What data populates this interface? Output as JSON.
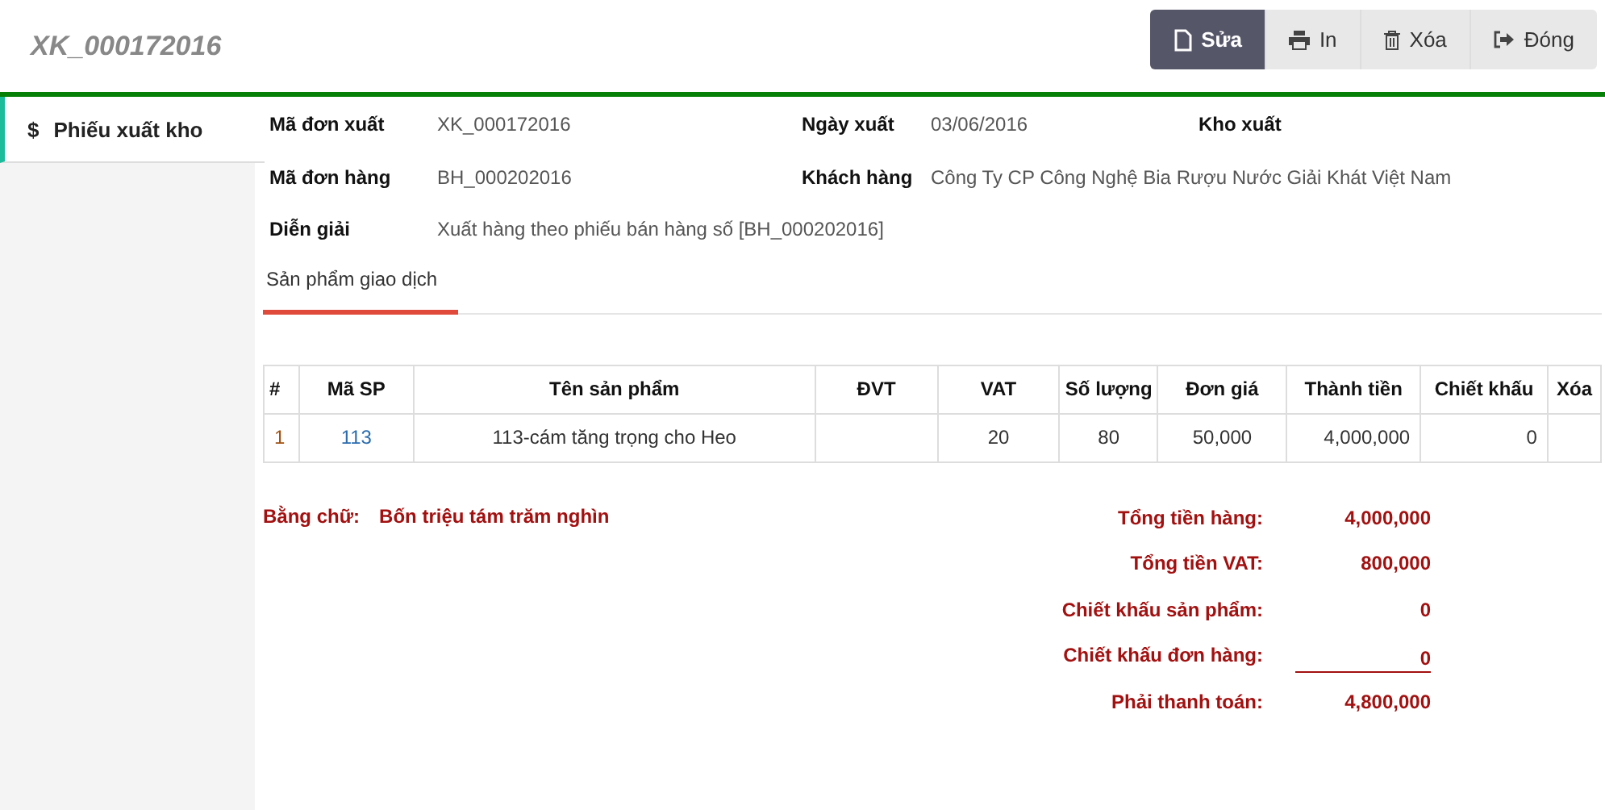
{
  "header": {
    "title": "XK_000172016"
  },
  "buttons": [
    {
      "label": "Sửa",
      "kind": "primary"
    },
    {
      "label": "In",
      "kind": "default"
    },
    {
      "label": "Xóa",
      "kind": "default"
    },
    {
      "label": "Đóng",
      "kind": "default"
    }
  ],
  "sidebar": {
    "items": [
      {
        "icon": "$",
        "label": "Phiếu xuất kho",
        "selected": true
      }
    ]
  },
  "details": [
    [
      {
        "label": "Mã đơn xuất",
        "value": "XK_000172016"
      },
      {
        "label": "Ngày xuất",
        "value": "03/06/2016"
      },
      {
        "label": "Kho xuất"
      }
    ],
    [
      {
        "label": "Mã đơn hàng",
        "value": "BH_000202016"
      },
      {
        "label": "Khách hàng",
        "value": "Công Ty CP Công Nghệ Bia Rượu Nước Giải Khát Việt Nam"
      }
    ],
    [
      {
        "label": "Diễn giải",
        "value": "Xuất hàng theo phiếu bán hàng số [BH_000202016]"
      }
    ]
  ],
  "tabs": [
    {
      "label": "Sản phẩm giao dịch",
      "selected": true
    }
  ],
  "table": {
    "columns": [
      "#",
      "Mã SP",
      "Tên sản phẩm",
      "ĐVT",
      "VAT",
      "Số lượng",
      "Đơn giá",
      "Thành tiền",
      "Chiết khấu",
      "Xóa"
    ],
    "rows": [
      [
        "1",
        "113",
        "113-cám tăng trọng cho Heo",
        "",
        "20",
        "80",
        "50,000",
        "4,000,000",
        "0",
        ""
      ]
    ]
  },
  "in_words": {
    "label": "Bằng chữ:",
    "value": "Bốn triệu tám trăm nghìn"
  },
  "totals": [
    {
      "label": "Tổng tiền hàng:",
      "value": "4,000,000",
      "underlined": false
    },
    {
      "label": "Tổng tiền VAT:",
      "value": "800,000",
      "underlined": false
    },
    {
      "label": "Chiết khấu sản phẩm:",
      "value": "0",
      "underlined": false
    },
    {
      "label": "Chiết khấu đơn hàng:",
      "value": "0",
      "underlined": true
    },
    {
      "label": "Phải thanh toán:",
      "value": "4,800,000",
      "underlined": false
    }
  ]
}
